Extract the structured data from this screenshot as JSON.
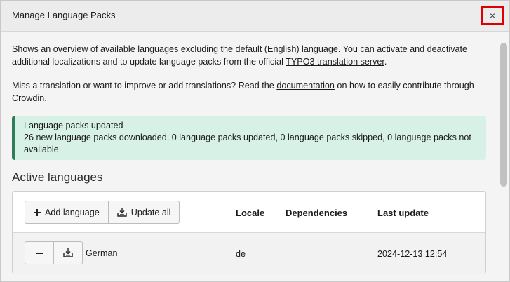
{
  "modal": {
    "title": "Manage Language Packs",
    "close_label": "×"
  },
  "intro": {
    "text_before_link": "Shows an overview of available languages excluding the default (English) language. You can activate and deactivate additional localizations and to update language packs from the official ",
    "link_text": "TYPO3 translation server",
    "text_after_link": "."
  },
  "help": {
    "text_before_doc": "Miss a translation or want to improve or add translations? Read the ",
    "doc_link": "documentation",
    "text_middle": " on how to easily contribute through ",
    "crowdin_link": "Crowdin",
    "text_end": "."
  },
  "alert": {
    "title": "Language packs updated",
    "message": "26 new language packs downloaded, 0 language packs updated, 0 language packs skipped, 0 language packs not available"
  },
  "active_languages": {
    "heading": "Active languages",
    "add_language_label": "Add language",
    "update_all_label": "Update all",
    "columns": {
      "locale": "Locale",
      "dependencies": "Dependencies",
      "last_update": "Last update"
    },
    "rows": [
      {
        "language": "German",
        "locale": "de",
        "dependencies": "",
        "last_update": "2024-12-13 12:54"
      }
    ]
  },
  "icons": {
    "close": "close-icon",
    "add": "plus-icon",
    "update": "download-icon",
    "remove": "minus-icon"
  }
}
